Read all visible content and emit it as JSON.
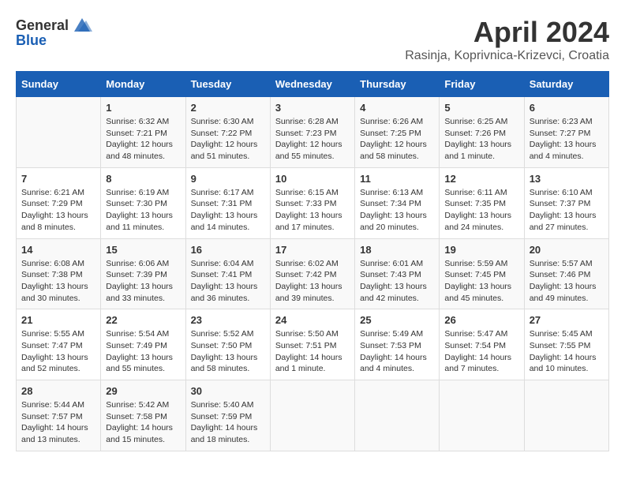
{
  "header": {
    "logo_general": "General",
    "logo_blue": "Blue",
    "title": "April 2024",
    "subtitle": "Rasinja, Koprivnica-Krizevci, Croatia"
  },
  "calendar": {
    "days_of_week": [
      "Sunday",
      "Monday",
      "Tuesday",
      "Wednesday",
      "Thursday",
      "Friday",
      "Saturday"
    ],
    "weeks": [
      [
        {
          "day": "",
          "info": ""
        },
        {
          "day": "1",
          "info": "Sunrise: 6:32 AM\nSunset: 7:21 PM\nDaylight: 12 hours\nand 48 minutes."
        },
        {
          "day": "2",
          "info": "Sunrise: 6:30 AM\nSunset: 7:22 PM\nDaylight: 12 hours\nand 51 minutes."
        },
        {
          "day": "3",
          "info": "Sunrise: 6:28 AM\nSunset: 7:23 PM\nDaylight: 12 hours\nand 55 minutes."
        },
        {
          "day": "4",
          "info": "Sunrise: 6:26 AM\nSunset: 7:25 PM\nDaylight: 12 hours\nand 58 minutes."
        },
        {
          "day": "5",
          "info": "Sunrise: 6:25 AM\nSunset: 7:26 PM\nDaylight: 13 hours\nand 1 minute."
        },
        {
          "day": "6",
          "info": "Sunrise: 6:23 AM\nSunset: 7:27 PM\nDaylight: 13 hours\nand 4 minutes."
        }
      ],
      [
        {
          "day": "7",
          "info": "Sunrise: 6:21 AM\nSunset: 7:29 PM\nDaylight: 13 hours\nand 8 minutes."
        },
        {
          "day": "8",
          "info": "Sunrise: 6:19 AM\nSunset: 7:30 PM\nDaylight: 13 hours\nand 11 minutes."
        },
        {
          "day": "9",
          "info": "Sunrise: 6:17 AM\nSunset: 7:31 PM\nDaylight: 13 hours\nand 14 minutes."
        },
        {
          "day": "10",
          "info": "Sunrise: 6:15 AM\nSunset: 7:33 PM\nDaylight: 13 hours\nand 17 minutes."
        },
        {
          "day": "11",
          "info": "Sunrise: 6:13 AM\nSunset: 7:34 PM\nDaylight: 13 hours\nand 20 minutes."
        },
        {
          "day": "12",
          "info": "Sunrise: 6:11 AM\nSunset: 7:35 PM\nDaylight: 13 hours\nand 24 minutes."
        },
        {
          "day": "13",
          "info": "Sunrise: 6:10 AM\nSunset: 7:37 PM\nDaylight: 13 hours\nand 27 minutes."
        }
      ],
      [
        {
          "day": "14",
          "info": "Sunrise: 6:08 AM\nSunset: 7:38 PM\nDaylight: 13 hours\nand 30 minutes."
        },
        {
          "day": "15",
          "info": "Sunrise: 6:06 AM\nSunset: 7:39 PM\nDaylight: 13 hours\nand 33 minutes."
        },
        {
          "day": "16",
          "info": "Sunrise: 6:04 AM\nSunset: 7:41 PM\nDaylight: 13 hours\nand 36 minutes."
        },
        {
          "day": "17",
          "info": "Sunrise: 6:02 AM\nSunset: 7:42 PM\nDaylight: 13 hours\nand 39 minutes."
        },
        {
          "day": "18",
          "info": "Sunrise: 6:01 AM\nSunset: 7:43 PM\nDaylight: 13 hours\nand 42 minutes."
        },
        {
          "day": "19",
          "info": "Sunrise: 5:59 AM\nSunset: 7:45 PM\nDaylight: 13 hours\nand 45 minutes."
        },
        {
          "day": "20",
          "info": "Sunrise: 5:57 AM\nSunset: 7:46 PM\nDaylight: 13 hours\nand 49 minutes."
        }
      ],
      [
        {
          "day": "21",
          "info": "Sunrise: 5:55 AM\nSunset: 7:47 PM\nDaylight: 13 hours\nand 52 minutes."
        },
        {
          "day": "22",
          "info": "Sunrise: 5:54 AM\nSunset: 7:49 PM\nDaylight: 13 hours\nand 55 minutes."
        },
        {
          "day": "23",
          "info": "Sunrise: 5:52 AM\nSunset: 7:50 PM\nDaylight: 13 hours\nand 58 minutes."
        },
        {
          "day": "24",
          "info": "Sunrise: 5:50 AM\nSunset: 7:51 PM\nDaylight: 14 hours\nand 1 minute."
        },
        {
          "day": "25",
          "info": "Sunrise: 5:49 AM\nSunset: 7:53 PM\nDaylight: 14 hours\nand 4 minutes."
        },
        {
          "day": "26",
          "info": "Sunrise: 5:47 AM\nSunset: 7:54 PM\nDaylight: 14 hours\nand 7 minutes."
        },
        {
          "day": "27",
          "info": "Sunrise: 5:45 AM\nSunset: 7:55 PM\nDaylight: 14 hours\nand 10 minutes."
        }
      ],
      [
        {
          "day": "28",
          "info": "Sunrise: 5:44 AM\nSunset: 7:57 PM\nDaylight: 14 hours\nand 13 minutes."
        },
        {
          "day": "29",
          "info": "Sunrise: 5:42 AM\nSunset: 7:58 PM\nDaylight: 14 hours\nand 15 minutes."
        },
        {
          "day": "30",
          "info": "Sunrise: 5:40 AM\nSunset: 7:59 PM\nDaylight: 14 hours\nand 18 minutes."
        },
        {
          "day": "",
          "info": ""
        },
        {
          "day": "",
          "info": ""
        },
        {
          "day": "",
          "info": ""
        },
        {
          "day": "",
          "info": ""
        }
      ]
    ]
  }
}
